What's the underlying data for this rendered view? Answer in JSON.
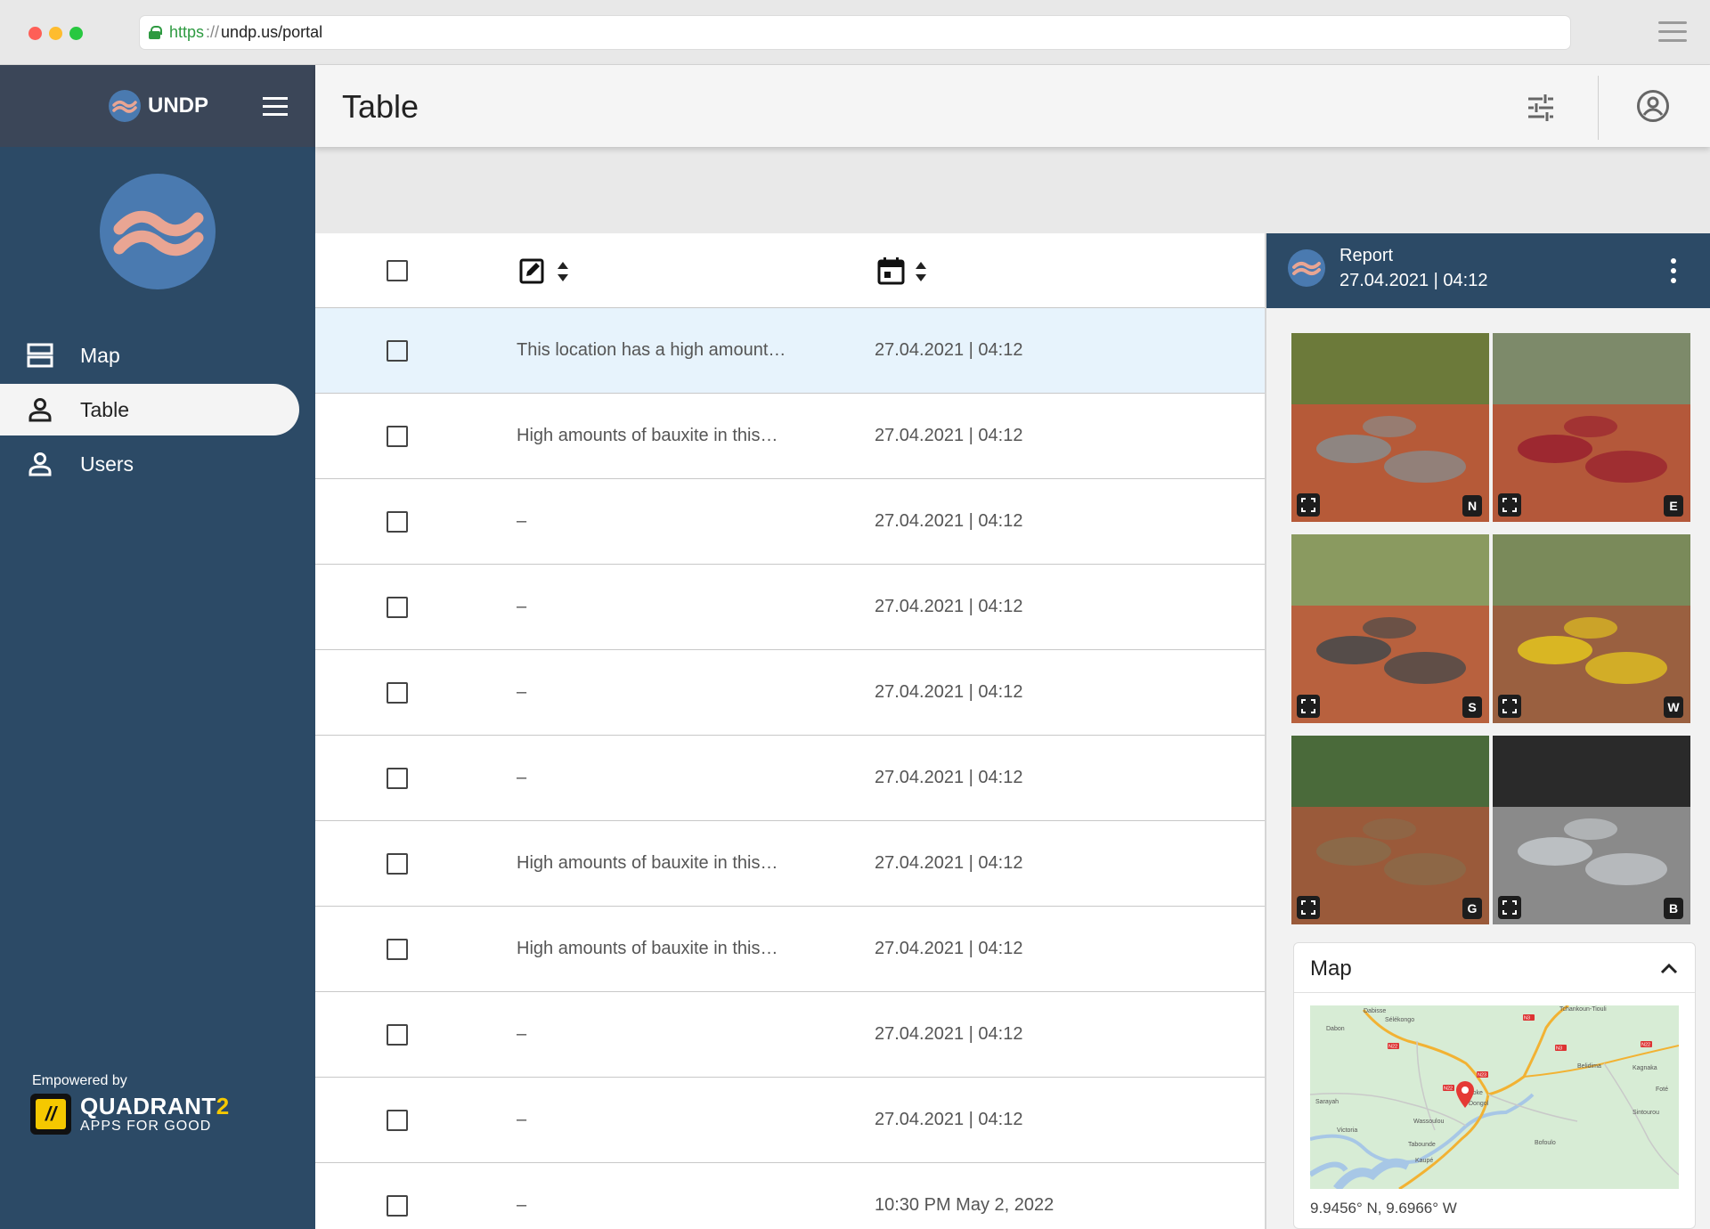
{
  "browser": {
    "url_scheme": "https",
    "url_sep": "://",
    "url_host": "undp.us/portal"
  },
  "sidebar": {
    "brand": "UNDP",
    "items": [
      {
        "label": "Map",
        "icon": "view-agenda-icon",
        "active": false
      },
      {
        "label": "Table",
        "icon": "person-icon",
        "active": true
      },
      {
        "label": "Users",
        "icon": "person-icon",
        "active": false
      }
    ],
    "empowered_by": "Empowered by",
    "partner_name_a": "QUADRANT",
    "partner_name_b": "2",
    "partner_tagline": "APPS FOR GOOD",
    "partner_badge": "//"
  },
  "appbar": {
    "title": "Table",
    "icons": [
      "tune-icon",
      "account-circle-icon"
    ]
  },
  "table": {
    "header_icons": [
      "edit-note-icon",
      "calendar-icon"
    ],
    "rows": [
      {
        "description": "This location has a high amount…",
        "date": "27.04.2021 | 04:12",
        "selected": true
      },
      {
        "description": "High amounts of bauxite in this…",
        "date": "27.04.2021 | 04:12",
        "selected": false
      },
      {
        "description": "–",
        "date": "27.04.2021 | 04:12",
        "selected": false
      },
      {
        "description": "–",
        "date": "27.04.2021 | 04:12",
        "selected": false
      },
      {
        "description": "–",
        "date": "27.04.2021 | 04:12",
        "selected": false
      },
      {
        "description": "–",
        "date": "27.04.2021 | 04:12",
        "selected": false
      },
      {
        "description": "High amounts of bauxite in this…",
        "date": "27.04.2021 | 04:12",
        "selected": false
      },
      {
        "description": "High amounts of bauxite in this…",
        "date": "27.04.2021 | 04:12",
        "selected": false
      },
      {
        "description": "–",
        "date": "27.04.2021 | 04:12",
        "selected": false
      },
      {
        "description": "–",
        "date": "27.04.2021 | 04:12",
        "selected": false
      },
      {
        "description": "–",
        "date": "10:30 PM May 2, 2022",
        "selected": false
      }
    ]
  },
  "report": {
    "title": "Report",
    "date": "27.04.2021 | 04:12",
    "photos": [
      {
        "direction": "N"
      },
      {
        "direction": "E"
      },
      {
        "direction": "S"
      },
      {
        "direction": "W"
      },
      {
        "direction": "G"
      },
      {
        "direction": "B"
      }
    ],
    "map": {
      "title": "Map",
      "coordinates": "9.9456° N, 9.6966° W",
      "places": [
        "Dabisse",
        "Sélékongo",
        "Dabon",
        "Tchankoun-Tiouli",
        "Belidima",
        "Kagnaka",
        "Boke",
        "Dongol",
        "Sarayah",
        "Wassoulou",
        "Victoria",
        "Tabounde",
        "Bofoulo",
        "Sintourou",
        "Kaupé",
        "Foté"
      ],
      "roads": [
        "N3",
        "N22",
        "N3",
        "N22",
        "N23",
        "N22"
      ]
    }
  },
  "colors": {
    "sidebar": "#2c4a66",
    "sidebar_top": "#3b4658",
    "selected_row": "#e7f3fc",
    "accent_yellow": "#f5c800",
    "logo_blue": "#4a7ab0",
    "logo_wave": "#e9a593"
  }
}
